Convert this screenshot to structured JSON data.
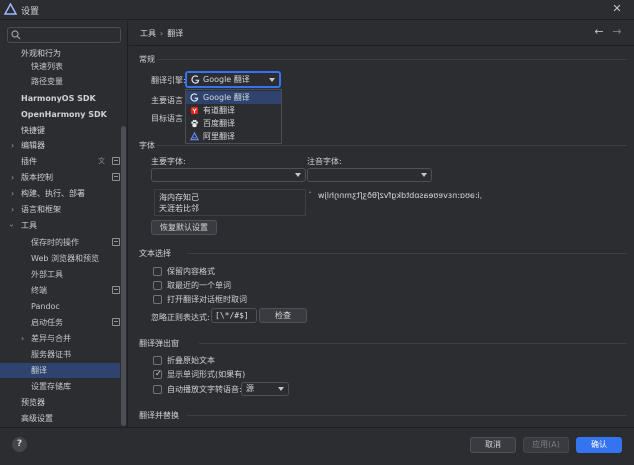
{
  "window": {
    "title": "设置",
    "close": "✕"
  },
  "search": {
    "placeholder": "",
    "value": ""
  },
  "sidebar": {
    "items": [
      {
        "label": "外观和行为"
      },
      {
        "label": "快速列表"
      },
      {
        "label": "路径变量"
      },
      {
        "label": "HarmonyOS SDK"
      },
      {
        "label": "OpenHarmony SDK"
      },
      {
        "label": "快捷键"
      },
      {
        "label": "编辑器"
      },
      {
        "label": "插件"
      },
      {
        "label": "版本控制"
      },
      {
        "label": "构建、执行、部署"
      },
      {
        "label": "语言和框架"
      },
      {
        "label": "工具"
      },
      {
        "label": "保存时的操作"
      },
      {
        "label": "Web 浏览器和预览"
      },
      {
        "label": "外部工具"
      },
      {
        "label": "终端"
      },
      {
        "label": "Pandoc"
      },
      {
        "label": "启动任务"
      },
      {
        "label": "差异与合并"
      },
      {
        "label": "服务器证书"
      },
      {
        "label": "翻译"
      },
      {
        "label": "设置存储库"
      },
      {
        "label": "预览器"
      },
      {
        "label": "高级设置"
      }
    ]
  },
  "breadcrumb": {
    "parent": "工具",
    "separator": "›",
    "current": "翻译"
  },
  "nav": {
    "back": "←",
    "forward": "→"
  },
  "general": {
    "title": "常规",
    "engine_label": "翻译引擎:",
    "engine_value": "Google 翻译",
    "primary_lang_label": "主要语言",
    "target_lang_label": "目标语言",
    "engine_options": [
      {
        "label": "Google 翻译",
        "icon": "google-icon",
        "selected": true
      },
      {
        "label": "有道翻译",
        "icon": "youdao-icon",
        "selected": false
      },
      {
        "label": "百度翻译",
        "icon": "baidu-icon",
        "selected": false
      },
      {
        "label": "阿里翻译",
        "icon": "alibaba-icon",
        "selected": false
      }
    ]
  },
  "fonts": {
    "title": "字体",
    "primary_label": "主要字体:",
    "phonetic_label": "注音字体:",
    "primary_value": "",
    "phonetic_value": "",
    "preview_line1": "海内存知己",
    "preview_line2": "天涯若比邻",
    "phonetic_preview": "ˌiːəʊɑːnɛvɐʊeasɒbtdkgfvzʃθðʒʃtʒmnŋhljw",
    "phonetic_mark": "ˆ",
    "restore_button": "恢复默认设置"
  },
  "text_selection": {
    "title": "文本选择",
    "options": [
      {
        "label": "保留内容格式",
        "checked": false
      },
      {
        "label": "取最近的一个单词",
        "checked": false
      },
      {
        "label": "打开翻译对话框时取词",
        "checked": false
      }
    ],
    "ignore_regex_label": "忽略正则表达式:",
    "ignore_regex_value": "[\\*/#$]",
    "check_button": "检查"
  },
  "translation_popup": {
    "title": "翻译弹出窗",
    "options": [
      {
        "label": "折叠原始文本",
        "checked": false
      },
      {
        "label": "显示单词形式(如果有)",
        "checked": true
      }
    ],
    "autoplay_label": "自动播放文字转语音:",
    "autoplay_value": "源"
  },
  "translate_replace": {
    "title": "翻译并替换"
  },
  "footer": {
    "help": "?",
    "cancel": "取消",
    "apply": "应用(A)",
    "ok": "确认"
  },
  "colors": {
    "accent": "#3574f0",
    "selection": "#2e436e",
    "background": "#2b2d30"
  }
}
